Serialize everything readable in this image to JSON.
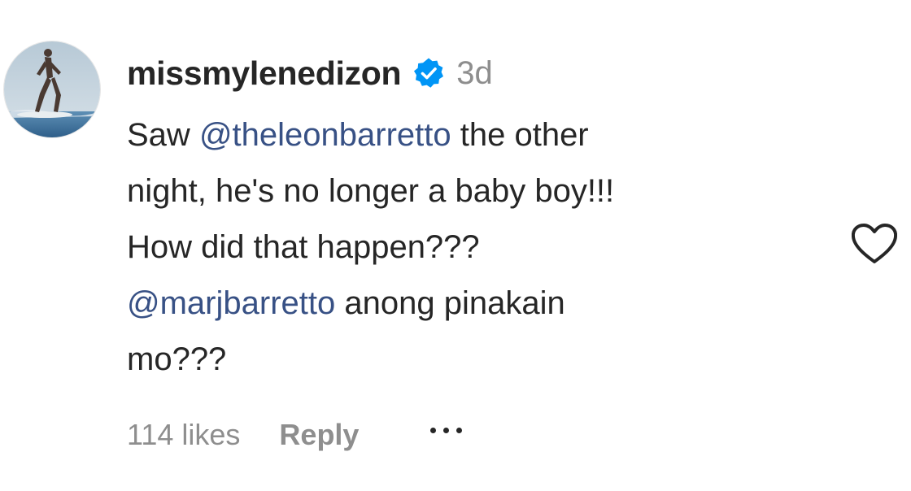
{
  "comment": {
    "username": "missmylenedizon",
    "verified_badge_icon": "verified-badge-icon",
    "time_ago": "3d",
    "text": {
      "line1": {
        "before": "Saw ",
        "mention": "@theleonbarretto",
        "after": " the other"
      },
      "line2": "night, he's no longer a baby boy!!!",
      "line3": "How did that happen???",
      "line4": {
        "mention": "@marjbarretto",
        "after": " anong pinakain"
      },
      "line5": "mo???"
    },
    "likes": "114 likes",
    "reply_label": "Reply",
    "heart_icon": "heart-outline-icon",
    "more_icon": "more-options-icon"
  },
  "colors": {
    "text": "#262626",
    "muted": "#8e8e8e",
    "mention": "#385185",
    "verified": "#0095f6"
  }
}
